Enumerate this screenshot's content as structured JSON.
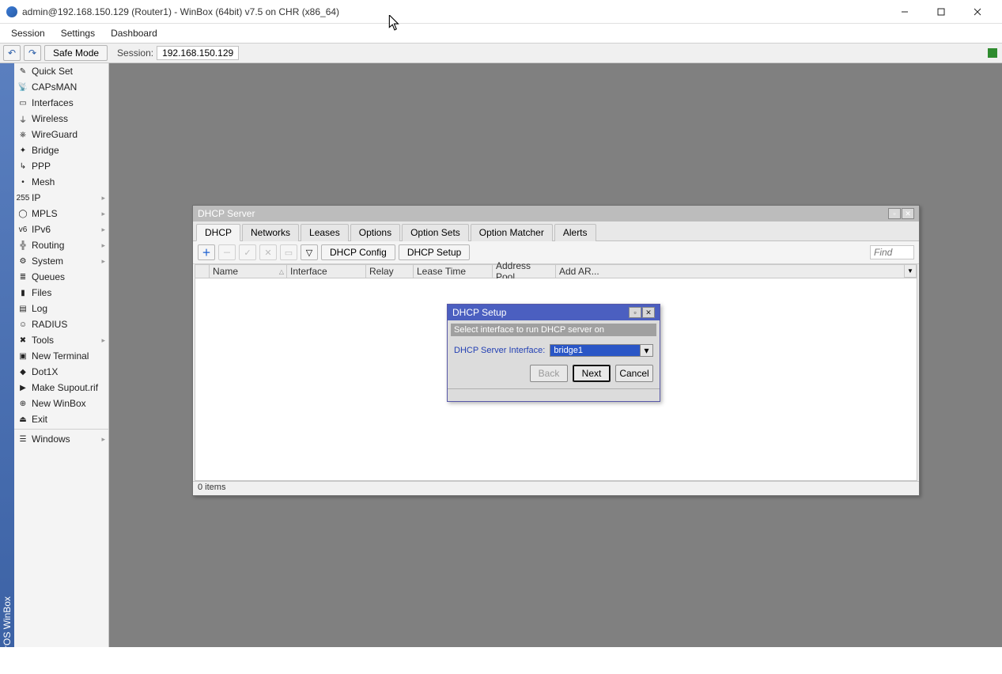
{
  "titlebar": {
    "title": "admin@192.168.150.129 (Router1) - WinBox (64bit) v7.5 on CHR (x86_64)"
  },
  "menubar": [
    "Session",
    "Settings",
    "Dashboard"
  ],
  "toolbar": {
    "safe_mode": "Safe Mode",
    "session_label": "Session:",
    "session_value": "192.168.150.129"
  },
  "sidebar_brand": "RouterOS WinBox",
  "sidebar": [
    {
      "label": "Quick Set",
      "icon": "✎",
      "arrow": false
    },
    {
      "label": "CAPsMAN",
      "icon": "📡",
      "arrow": false
    },
    {
      "label": "Interfaces",
      "icon": "▭",
      "arrow": false
    },
    {
      "label": "Wireless",
      "icon": "⏚",
      "arrow": false
    },
    {
      "label": "WireGuard",
      "icon": "⎈",
      "arrow": false
    },
    {
      "label": "Bridge",
      "icon": "✦",
      "arrow": false
    },
    {
      "label": "PPP",
      "icon": "↳",
      "arrow": false
    },
    {
      "label": "Mesh",
      "icon": "•",
      "arrow": false
    },
    {
      "label": "IP",
      "icon": "255",
      "arrow": true
    },
    {
      "label": "MPLS",
      "icon": "◯",
      "arrow": true
    },
    {
      "label": "IPv6",
      "icon": "v6",
      "arrow": true
    },
    {
      "label": "Routing",
      "icon": "╬",
      "arrow": true
    },
    {
      "label": "System",
      "icon": "⚙",
      "arrow": true
    },
    {
      "label": "Queues",
      "icon": "≣",
      "arrow": false
    },
    {
      "label": "Files",
      "icon": "▮",
      "arrow": false
    },
    {
      "label": "Log",
      "icon": "▤",
      "arrow": false
    },
    {
      "label": "RADIUS",
      "icon": "☺",
      "arrow": false
    },
    {
      "label": "Tools",
      "icon": "✖",
      "arrow": true
    },
    {
      "label": "New Terminal",
      "icon": "▣",
      "arrow": false
    },
    {
      "label": "Dot1X",
      "icon": "◆",
      "arrow": false
    },
    {
      "label": "Make Supout.rif",
      "icon": "▶",
      "arrow": false
    },
    {
      "label": "New WinBox",
      "icon": "⊕",
      "arrow": false
    },
    {
      "label": "Exit",
      "icon": "⏏",
      "arrow": false
    }
  ],
  "sidebar_windows": {
    "label": "Windows",
    "icon": "☰",
    "arrow": true
  },
  "dhcp_window": {
    "title": "DHCP Server",
    "tabs": [
      "DHCP",
      "Networks",
      "Leases",
      "Options",
      "Option Sets",
      "Option Matcher",
      "Alerts"
    ],
    "active_tab": 0,
    "btn_config": "DHCP Config",
    "btn_setup": "DHCP Setup",
    "find_placeholder": "Find",
    "columns": [
      "",
      "Name",
      "Interface",
      "Relay",
      "Lease Time",
      "Address Pool",
      "Add AR..."
    ],
    "status": "0 items"
  },
  "setup_dialog": {
    "title": "DHCP Setup",
    "instruction": "Select interface to run DHCP server on",
    "field_label": "DHCP Server Interface:",
    "field_value": "bridge1",
    "back": "Back",
    "next": "Next",
    "cancel": "Cancel"
  }
}
